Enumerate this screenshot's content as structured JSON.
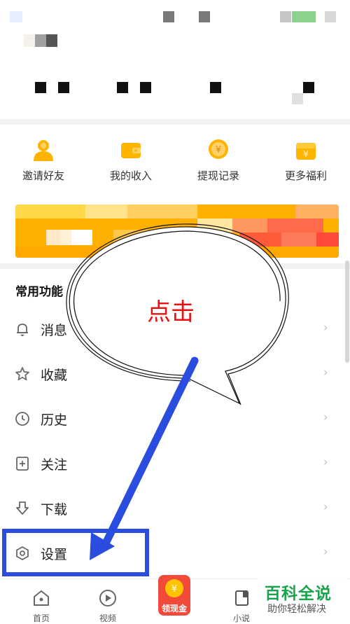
{
  "quick_actions": [
    {
      "label": "邀请好友",
      "icon": "person-icon"
    },
    {
      "label": "我的收入",
      "icon": "wallet-icon"
    },
    {
      "label": "提现记录",
      "icon": "coin-icon"
    },
    {
      "label": "更多福利",
      "icon": "gift-icon"
    }
  ],
  "section_title": "常用功能",
  "menu": [
    {
      "label": "消息",
      "icon": "bell-icon"
    },
    {
      "label": "收藏",
      "icon": "star-icon"
    },
    {
      "label": "历史",
      "icon": "clock-icon"
    },
    {
      "label": "关注",
      "icon": "add-follow-icon"
    },
    {
      "label": "下载",
      "icon": "download-icon"
    },
    {
      "label": "设置",
      "icon": "settings-icon"
    }
  ],
  "chevron": "›",
  "bottom_nav": [
    {
      "label": "首页",
      "icon": "home-icon"
    },
    {
      "label": "视频",
      "icon": "play-icon"
    },
    {
      "label": "领现金",
      "icon": "yen-coin-icon"
    },
    {
      "label": "小说",
      "icon": "book-icon"
    }
  ],
  "annotation": {
    "callout_text": "点击"
  },
  "watermark": {
    "title": "百科全说",
    "subtitle": "助你轻松解决"
  },
  "colors": {
    "accent": "#ffb400",
    "annotation_blue": "#2a4de0",
    "callout_red": "#e81010",
    "watermark_green": "#1aa34a"
  }
}
